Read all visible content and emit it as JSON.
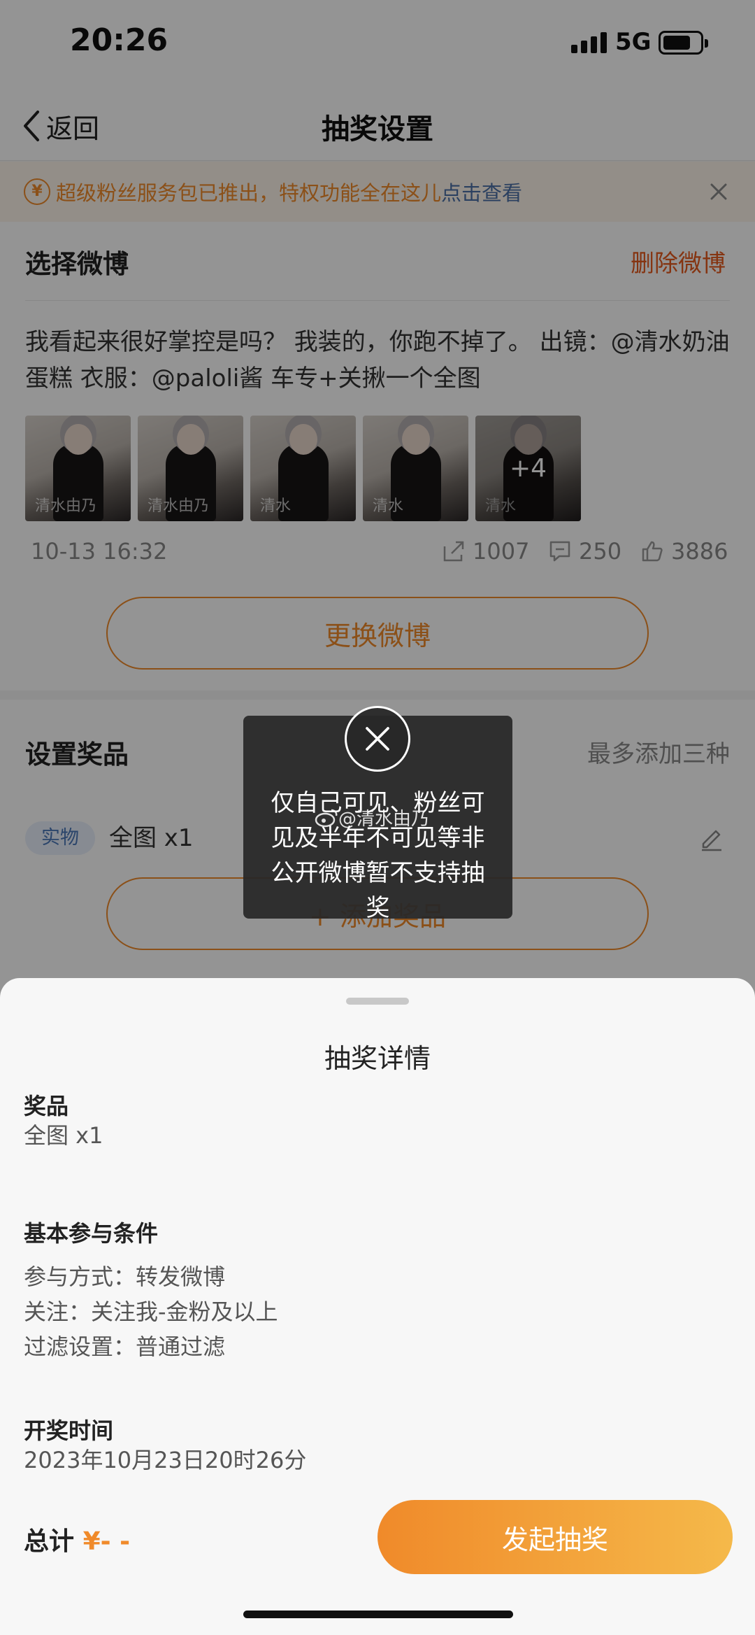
{
  "status_bar": {
    "time": "20:26",
    "network": "5G"
  },
  "nav": {
    "back_label": "返回",
    "title": "抽奖设置"
  },
  "banner": {
    "text": "超级粉丝服务包已推出，特权功能全在这儿",
    "link": "点击查看"
  },
  "weibo_card": {
    "title": "选择微博",
    "delete_label": "删除微博",
    "post_text": "我看起来很好掌控是吗？ 我装的，你跑不掉了。 出镜：@清水奶油蛋糕 衣服：@paloli酱 车专+关揪一个全图",
    "thumbnails": [
      {
        "watermark": "清水由乃"
      },
      {
        "watermark": "清水由乃"
      },
      {
        "watermark": "清水"
      },
      {
        "watermark": "清水"
      },
      {
        "watermark": "清水",
        "more": "+4"
      }
    ],
    "time": "10-13 16:32",
    "reposts": "1007",
    "comments": "250",
    "likes": "3886",
    "change_label": "更换微博"
  },
  "prize_card": {
    "title": "设置奖品",
    "hint": "最多添加三种",
    "tag": "实物",
    "name": "全图 x1",
    "add_label": "+ 添加奖品"
  },
  "toast": {
    "text": "仅自己可见、粉丝可见及半年不可见等非公开微博暂不支持抽奖",
    "watermark": "@清水由乃"
  },
  "sheet": {
    "title": "抽奖详情",
    "prize_heading": "奖品",
    "prize_value": "全图 x1",
    "conditions_heading": "基本参与条件",
    "conditions": [
      "参与方式：转发微博",
      "关注：关注我-金粉及以上",
      "过滤设置：普通过滤"
    ],
    "draw_time_heading": "开奖时间",
    "draw_time_value": "2023年10月23日20时26分",
    "total_label": "总计",
    "total_value": "¥- -",
    "start_label": "发起抽奖"
  },
  "colors": {
    "accent": "#f08a2a",
    "link": "#4a6fa5",
    "danger": "#e65a1e"
  }
}
